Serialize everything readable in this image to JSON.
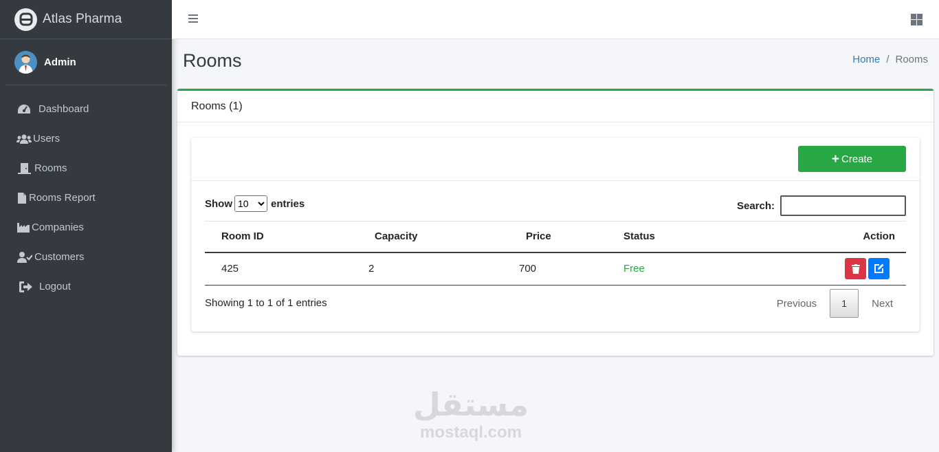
{
  "brand": {
    "name": "Atlas Pharma"
  },
  "user": {
    "name": "Admin"
  },
  "sidebar": {
    "items": [
      {
        "label": "Dashboard",
        "icon": "tachometer-icon"
      },
      {
        "label": "Users",
        "icon": "users-icon"
      },
      {
        "label": "Rooms",
        "icon": "door-icon"
      },
      {
        "label": "Rooms Report",
        "icon": "file-icon"
      },
      {
        "label": "Companies",
        "icon": "industry-icon"
      },
      {
        "label": "Customers",
        "icon": "user-check-icon"
      },
      {
        "label": "Logout",
        "icon": "sign-out-icon"
      }
    ]
  },
  "header": {
    "title": "Rooms"
  },
  "breadcrumb": {
    "home": "Home",
    "separator": "/",
    "current": "Rooms"
  },
  "card": {
    "title": "Rooms (1)",
    "accent": "#28a745"
  },
  "toolbar": {
    "create_label": "Create"
  },
  "table_controls": {
    "show_label": "Show",
    "entries_label": "entries",
    "page_size": "10",
    "search_label": "Search:",
    "search_value": ""
  },
  "table": {
    "columns": [
      "Room ID",
      "Capacity",
      "Price",
      "Status",
      "Action"
    ],
    "rows": [
      {
        "room_id": "425",
        "capacity": "2",
        "price": "700",
        "status": "Free"
      }
    ]
  },
  "footer": {
    "info": "Showing 1 to 1 of 1 entries",
    "previous": "Previous",
    "current_page": "1",
    "next": "Next"
  },
  "watermark": {
    "arabic": "مستقل",
    "latin": "mostaql.com"
  },
  "colors": {
    "sidebar": "#343a40",
    "success": "#28a745",
    "danger": "#dc3545",
    "primary": "#007bff",
    "link": "#337ab7"
  }
}
